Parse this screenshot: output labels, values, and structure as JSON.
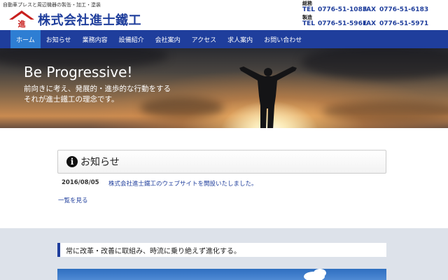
{
  "header": {
    "tagline": "自動車プレスと周辺機器の製缶・加工・塗装",
    "logo_mark": "進",
    "company_name": "株式会社進士鐵工",
    "contacts": [
      {
        "label": "総務",
        "tel_label": "TEL",
        "tel": "0776-51-1083",
        "fax_label": "FAX",
        "fax": "0776-51-6183"
      },
      {
        "label": "製造",
        "tel_label": "TEL",
        "tel": "0776-51-5961",
        "fax_label": "FAX",
        "fax": "0776-51-5971"
      }
    ]
  },
  "nav": {
    "items": [
      {
        "label": "ホーム",
        "active": true
      },
      {
        "label": "お知らせ"
      },
      {
        "label": "業務内容"
      },
      {
        "label": "設備紹介"
      },
      {
        "label": "会社案内"
      },
      {
        "label": "アクセス"
      },
      {
        "label": "求人案内"
      },
      {
        "label": "お問い合わせ"
      }
    ]
  },
  "hero": {
    "title": "Be Progressive!",
    "subtitle_line1": "前向きに考え、発展的・進歩的な行動をする",
    "subtitle_line2": "それが進士鐵工の理念です。"
  },
  "news": {
    "icon": "info-icon",
    "heading": "お知らせ",
    "items": [
      {
        "date": "2016/08/05",
        "title": "株式会社進士鐵工のウェブサイトを開設いたしました。"
      }
    ],
    "more_label": "一覧を見る"
  },
  "band": {
    "heading": "常に改革・改善に取組み、時流に乗り絶えず進化する。"
  },
  "colors": {
    "brand_blue": "#1f3e9c",
    "nav_active": "#2e7ed3",
    "logo_red": "#c8201e"
  }
}
